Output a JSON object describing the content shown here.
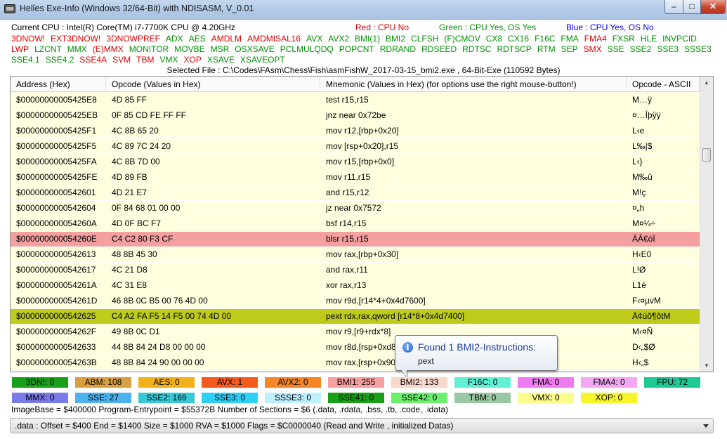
{
  "window": {
    "title": "Helles Exe-Info (Windows 32/64-Bit) with NDISASM, V_0.01"
  },
  "controls": {
    "minimize": "–",
    "maximize": "□",
    "close": "✕"
  },
  "cpu": {
    "label": "Current CPU : Intel(R) Core(TM) i7-7700K CPU @ 4.20GHz",
    "legend_red": "Red : CPU No",
    "legend_green": "Green : CPU Yes, OS Yes",
    "legend_blue": "Blue : CPU Yes, OS No"
  },
  "flags": [
    {
      "name": "3DNOW!",
      "color": "red"
    },
    {
      "name": "EXT3DNOW!",
      "color": "red"
    },
    {
      "name": "3DNOWPREF",
      "color": "red"
    },
    {
      "name": "ADX",
      "color": "green"
    },
    {
      "name": "AES",
      "color": "green"
    },
    {
      "name": "AMDLM",
      "color": "red"
    },
    {
      "name": "AMDMISAL16",
      "color": "red"
    },
    {
      "name": "AVX",
      "color": "green"
    },
    {
      "name": "AVX2",
      "color": "green"
    },
    {
      "name": "BMI(1)",
      "color": "green"
    },
    {
      "name": "BMI2",
      "color": "green"
    },
    {
      "name": "CLFSH",
      "color": "green"
    },
    {
      "name": "(F)CMOV",
      "color": "green"
    },
    {
      "name": "CX8",
      "color": "green"
    },
    {
      "name": "CX16",
      "color": "green"
    },
    {
      "name": "F16C",
      "color": "green"
    },
    {
      "name": "FMA",
      "color": "green"
    },
    {
      "name": "FMA4",
      "color": "red"
    },
    {
      "name": "FXSR",
      "color": "green"
    },
    {
      "name": "HLE",
      "color": "green"
    },
    {
      "name": "INVPCID",
      "color": "green"
    },
    {
      "name": "LWP",
      "color": "red"
    },
    {
      "name": "LZCNT",
      "color": "green"
    },
    {
      "name": "MMX",
      "color": "green"
    },
    {
      "name": "(E)MMX",
      "color": "red"
    },
    {
      "name": "MONITOR",
      "color": "green"
    },
    {
      "name": "MOVBE",
      "color": "green"
    },
    {
      "name": "MSR",
      "color": "green"
    },
    {
      "name": "OSXSAVE",
      "color": "green"
    },
    {
      "name": "PCLMULQDQ",
      "color": "green"
    },
    {
      "name": "POPCNT",
      "color": "green"
    },
    {
      "name": "RDRAND",
      "color": "green"
    },
    {
      "name": "RDSEED",
      "color": "green"
    },
    {
      "name": "RDTSC",
      "color": "green"
    },
    {
      "name": "RDTSCP",
      "color": "green"
    },
    {
      "name": "RTM",
      "color": "green"
    },
    {
      "name": "SEP",
      "color": "green"
    },
    {
      "name": "SMX",
      "color": "red"
    },
    {
      "name": "SSE",
      "color": "green"
    },
    {
      "name": "SSE2",
      "color": "green"
    },
    {
      "name": "SSE3",
      "color": "green"
    },
    {
      "name": "SSSE3",
      "color": "green"
    },
    {
      "name": "SSE4.1",
      "color": "green"
    },
    {
      "name": "SSE4.2",
      "color": "green"
    },
    {
      "name": "SSE4A",
      "color": "red"
    },
    {
      "name": "SVM",
      "color": "red"
    },
    {
      "name": "TBM",
      "color": "red"
    },
    {
      "name": "VMX",
      "color": "green"
    },
    {
      "name": "XOP",
      "color": "red"
    },
    {
      "name": "XSAVE",
      "color": "green"
    },
    {
      "name": "XSAVEOPT",
      "color": "green"
    }
  ],
  "selected_file": "Selected File : C:\\Codes\\FAsm\\Chess\\Fish\\asmFishW_2017-03-15_bmi2.exe , 64-Bit-Exe  (110592 Bytes)",
  "table": {
    "headers": [
      "Address (Hex)",
      "Opcode (Values in Hex)",
      "Mnemonic (Values in Hex)   (for options use the right mouse-button!)",
      "Opcode - ASCII"
    ],
    "rows": [
      {
        "addr": "$00000000005425E8",
        "opcode": "4D 85 FF",
        "mnemonic": "test r15,r15",
        "ascii": "M…ÿ",
        "hl": ""
      },
      {
        "addr": "$00000000005425EB",
        "opcode": "0F 85 CD FE FF FF",
        "mnemonic": "jnz near 0x72be",
        "ascii": "¤…Íþÿÿ",
        "hl": ""
      },
      {
        "addr": "$00000000005425F1",
        "opcode": "4C 8B 65 20",
        "mnemonic": "mov r12,[rbp+0x20]",
        "ascii": "L‹e",
        "hl": ""
      },
      {
        "addr": "$00000000005425F5",
        "opcode": "4C 89 7C 24 20",
        "mnemonic": "mov [rsp+0x20],r15",
        "ascii": "L‰|$",
        "hl": ""
      },
      {
        "addr": "$00000000005425FA",
        "opcode": "4C 8B 7D 00",
        "mnemonic": "mov r15,[rbp+0x0]",
        "ascii": "L‹}",
        "hl": ""
      },
      {
        "addr": "$00000000005425FE",
        "opcode": "4D 89 FB",
        "mnemonic": "mov r11,r15",
        "ascii": "M‰û",
        "hl": ""
      },
      {
        "addr": "$0000000000542601",
        "opcode": "4D 21 E7",
        "mnemonic": "and r15,r12",
        "ascii": "M!ç",
        "hl": ""
      },
      {
        "addr": "$0000000000542604",
        "opcode": "0F 84 68 01 00 00",
        "mnemonic": "jz near 0x7572",
        "ascii": "¤„h",
        "hl": ""
      },
      {
        "addr": "$000000000054260A",
        "opcode": "4D 0F BC F7",
        "mnemonic": "bsf r14,r15",
        "ascii": "M¤¼÷",
        "hl": ""
      },
      {
        "addr": "$000000000054260E",
        "opcode": "C4 C2 80 F3 CF",
        "mnemonic": "blsr r15,r15",
        "ascii": "ÄÂ€óÏ",
        "hl": "red"
      },
      {
        "addr": "$0000000000542613",
        "opcode": "48 8B 45 30",
        "mnemonic": "mov rax,[rbp+0x30]",
        "ascii": "H‹E0",
        "hl": ""
      },
      {
        "addr": "$0000000000542617",
        "opcode": "4C 21 D8",
        "mnemonic": "and rax,r11",
        "ascii": "L!Ø",
        "hl": ""
      },
      {
        "addr": "$000000000054261A",
        "opcode": "4C 31 E8",
        "mnemonic": "xor rax,r13",
        "ascii": "L1è",
        "hl": ""
      },
      {
        "addr": "$000000000054261D",
        "opcode": "46 8B 0C B5 00 76 4D 00",
        "mnemonic": "mov r9d,[r14*4+0x4d7600]",
        "ascii": "F‹¤µvM",
        "hl": ""
      },
      {
        "addr": "$0000000000542625",
        "opcode": "C4 A2 FA F5 14 F5 00 74 4D 00",
        "mnemonic": "pext rdx,rax,qword [r14*8+0x4d7400]",
        "ascii": "Ä¢úõ¶õtM",
        "hl": "olive"
      },
      {
        "addr": "$000000000054262F",
        "opcode": "49 8B 0C D1",
        "mnemonic": "mov r9,[r9+rdx*8]",
        "ascii": "M‹¤Ñ",
        "hl": ""
      },
      {
        "addr": "$0000000000542633",
        "opcode": "44 8B 84 24 D8 00 00 00",
        "mnemonic": "mov r8d,[rsp+0xd8]",
        "ascii": "D‹„$Ø",
        "hl": ""
      },
      {
        "addr": "$000000000054263B",
        "opcode": "48 8B 84 24 90 00 00 00",
        "mnemonic": "mov rax,[rsp+0x90]",
        "ascii": "H‹„$",
        "hl": ""
      }
    ]
  },
  "tooltip": {
    "title": "Found 1 BMI2-Instructions:",
    "body": "pext"
  },
  "stats": [
    {
      "label": "3DN!: 0",
      "color": "#19a019"
    },
    {
      "label": "ABM: 108",
      "color": "#d9a040"
    },
    {
      "label": "AES: 0",
      "color": "#f2b01a"
    },
    {
      "label": "AVX: 1",
      "color": "#f45a1c"
    },
    {
      "label": "AVX2: 0",
      "color": "#f58526"
    },
    {
      "label": "BMI1: 255",
      "color": "#f7a0a0"
    },
    {
      "label": "BMI2: 133",
      "color": "#fad7cb"
    },
    {
      "label": "F16C: 0",
      "color": "#62f0d4"
    },
    {
      "label": "FMA: 0",
      "color": "#f07af0"
    },
    {
      "label": "FMA4: 0",
      "color": "#f4a8f4"
    },
    {
      "label": "FPU: 72",
      "color": "#1fc895"
    },
    {
      "label": "MMX: 0",
      "color": "#7a7ae8"
    },
    {
      "label": "SSE: 27",
      "color": "#4cb2ee"
    },
    {
      "label": "SSE2: 169",
      "color": "#38c8d6"
    },
    {
      "label": "SSE3: 0",
      "color": "#2cd0f4"
    },
    {
      "label": "SSSE3: 0",
      "color": "#bff0ff"
    },
    {
      "label": "SSE41: 0",
      "color": "#18a018"
    },
    {
      "label": "SSE42: 0",
      "color": "#6cf06c"
    },
    {
      "label": "TBM: 0",
      "color": "#9ac8a4"
    },
    {
      "label": "VMX: 0",
      "color": "#fbfb8c"
    },
    {
      "label": "XOP: 0",
      "color": "#f6f62a"
    }
  ],
  "footer": {
    "info": "ImageBase = $400000   Program-Entrypoint = $55372B   Number of Sections = $6 (.data, .rdata, .bss, .tb, .code, .idata)",
    "section": ".data : Offset = $400  End = $1400  Size = $1000  RVA = $1000  Flags = $C0000040 (Read and Write , initialized Datas)"
  }
}
